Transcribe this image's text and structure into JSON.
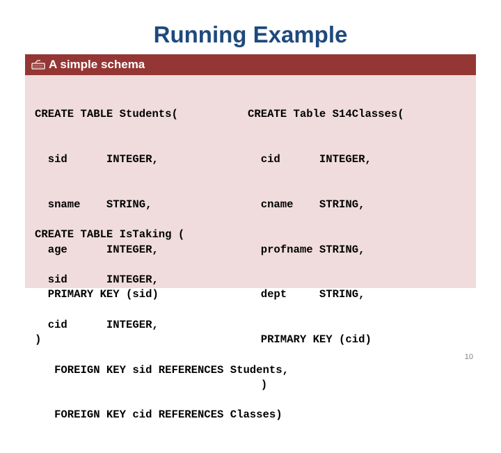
{
  "slide": {
    "title": "Running Example",
    "page_number": "10"
  },
  "panel": {
    "header_icon": "keyboard-icon",
    "header_label": "A simple schema",
    "colors": {
      "header_bg": "#943634",
      "body_bg": "#f0dcdc",
      "title": "#1f497d"
    },
    "students_table": [
      "CREATE TABLE Students(",
      "  sid      INTEGER,",
      "  sname    STRING,",
      "  age      INTEGER,",
      "  PRIMARY KEY (sid)",
      ")"
    ],
    "classes_table": [
      "CREATE Table S14Classes(",
      "  cid      INTEGER,",
      "  cname    STRING,",
      "  profname STRING,",
      "  dept     STRING,",
      "  PRIMARY KEY (cid)",
      "  )"
    ],
    "istaking_table": [
      "CREATE TABLE IsTaking (",
      "  sid      INTEGER,",
      "  cid      INTEGER,",
      "   FOREIGN KEY sid REFERENCES Students,",
      "   FOREIGN KEY cid REFERENCES Classes)"
    ]
  }
}
